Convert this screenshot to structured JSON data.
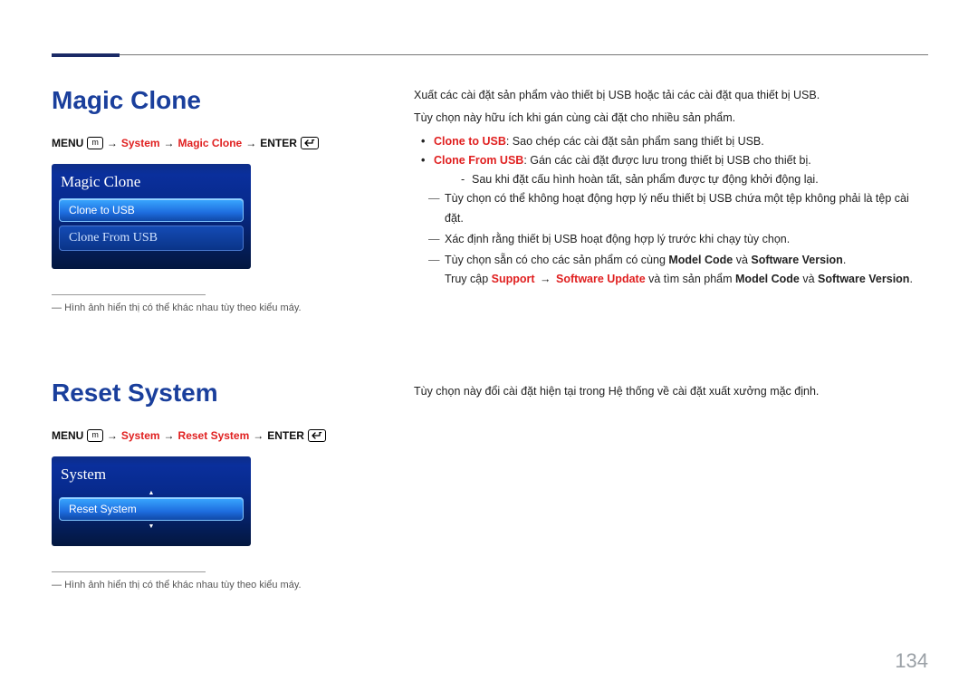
{
  "page_number": "134",
  "section1": {
    "title": "Magic Clone",
    "nav": {
      "menu": "MENU",
      "menu_icon": "m",
      "system": "System",
      "item": "Magic Clone",
      "enter": "ENTER"
    },
    "tv": {
      "heading": "Magic Clone",
      "opt_selected": "Clone to USB",
      "opt2": "Clone From USB"
    },
    "note": "Hình ảnh hiển thị có thể khác nhau tùy theo kiểu máy.",
    "body": {
      "p1": "Xuất các cài đặt sản phẩm vào thiết bị USB hoặc tải các cài đặt qua thiết bị USB.",
      "p2": "Tùy chọn này hữu ích khi gán cùng cài đặt cho nhiều sản phẩm.",
      "b1_label": "Clone to USB",
      "b1_text": ": Sao chép các cài đặt sản phẩm sang thiết bị USB.",
      "b2_label": "Clone From USB",
      "b2_text": ": Gán các cài đặt được lưu trong thiết bị USB cho thiết bị.",
      "b2_sub": "Sau khi đặt cấu hình hoàn tất, sản phẩm được tự động khởi động lại.",
      "d1": "Tùy chọn có thể không hoạt động hợp lý nếu thiết bị USB chứa một tệp không phải là tệp cài đặt.",
      "d2": "Xác định rằng thiết bị USB hoạt động hợp lý trước khi chạy tùy chọn.",
      "d3_pre": "Tùy chọn sẵn có cho các sản phẩm có cùng ",
      "d3_mc": "Model Code",
      "d3_mid": " và ",
      "d3_sv": "Software Version",
      "d3_end": ".",
      "d3a_pre": "Truy cập ",
      "d3a_support": "Support",
      "d3a_arrow": " → ",
      "d3a_su": "Software Update",
      "d3a_mid": " và tìm sản phẩm ",
      "d3a_mc": "Model Code",
      "d3a_and": " và ",
      "d3a_sv": "Software Version",
      "d3a_end": "."
    }
  },
  "section2": {
    "title": "Reset System",
    "nav": {
      "menu": "MENU",
      "menu_icon": "m",
      "system": "System",
      "item": "Reset System",
      "enter": "ENTER"
    },
    "tv": {
      "heading": "System",
      "opt_selected": "Reset System"
    },
    "note": "Hình ảnh hiển thị có thể khác nhau tùy theo kiểu máy.",
    "body": {
      "p1": "Tùy chọn này đổi cài đặt hiện tại trong Hệ thống về cài đặt xuất xưởng mặc định."
    }
  }
}
